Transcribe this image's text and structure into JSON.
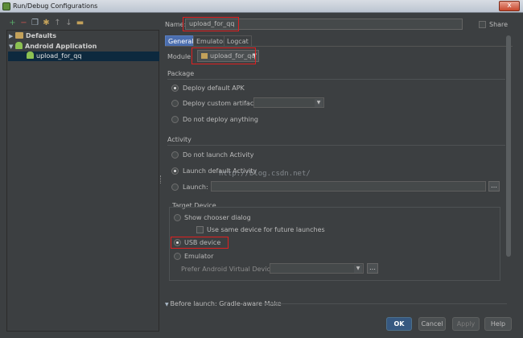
{
  "window": {
    "title": "Run/Debug Configurations",
    "close_glyph": "x"
  },
  "toolbar": {
    "icons": [
      "add-icon",
      "remove-icon",
      "copy-icon",
      "settings-icon",
      "move-up-icon",
      "move-down-icon",
      "folder-icon"
    ]
  },
  "tree": {
    "defaults": "Defaults",
    "android_application": "Android Application",
    "selected_config": "upload_for_qq"
  },
  "form": {
    "name_label": "Name:",
    "name_value": "upload_for_qq",
    "share_label": "Share",
    "tabs": [
      "General",
      "Emulator",
      "Logcat"
    ],
    "module_label": "Module:",
    "module_value": "upload_for_qq"
  },
  "package": {
    "title": "Package",
    "options": [
      "Deploy default APK",
      "Deploy custom artifact:",
      "Do not deploy anything"
    ],
    "selected_index": 0
  },
  "activity": {
    "title": "Activity",
    "options": [
      "Do not launch Activity",
      "Launch default Activity",
      "Launch:"
    ],
    "selected_index": 1
  },
  "target_device": {
    "title": "Target Device",
    "show_chooser": "Show chooser dialog",
    "use_same": "Use same device for future launches",
    "usb_device": "USB device",
    "emulator": "Emulator",
    "prefer_avd_label": "Prefer Android Virtual Device:",
    "selected": "usb_device"
  },
  "before_launch": "Before launch: Gradle-aware Make",
  "buttons": {
    "ok": "OK",
    "cancel": "Cancel",
    "apply": "Apply",
    "help": "Help"
  },
  "watermark": "http://blog.csdn.net/",
  "colors": {
    "accent": "#4b6eaf",
    "highlight": "#e02020",
    "background": "#3c3f41"
  }
}
